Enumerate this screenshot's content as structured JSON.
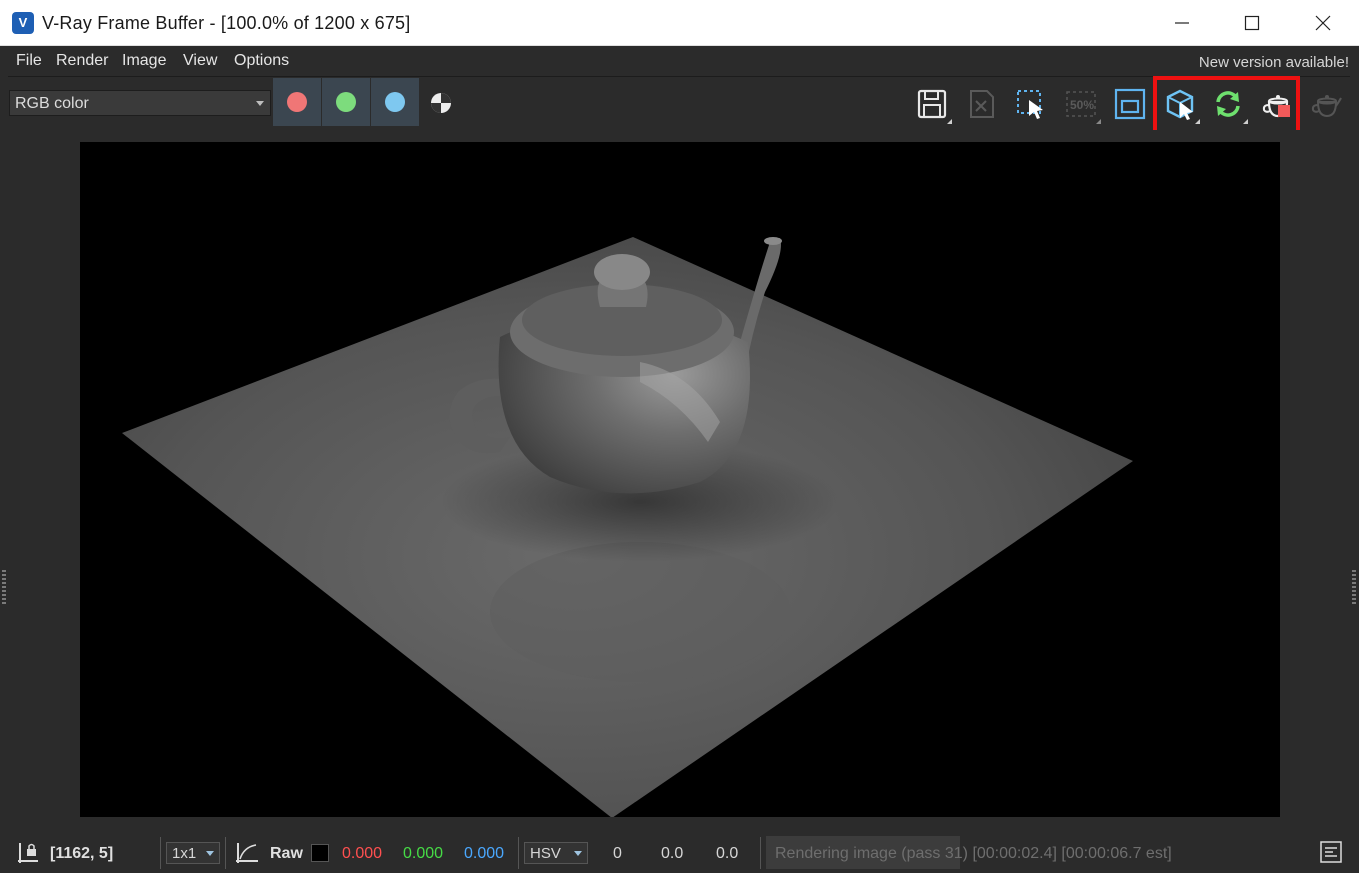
{
  "window": {
    "title": "V-Ray Frame Buffer - [100.0% of 1200 x 675]",
    "logo_letter": "V"
  },
  "menu": {
    "items": [
      "File",
      "Render",
      "Image",
      "View",
      "Options"
    ],
    "notice": "New version available!"
  },
  "toolbar": {
    "channel": "RGB color",
    "channel_buttons": [
      {
        "name": "red-channel",
        "color": "#f07676"
      },
      {
        "name": "green-channel",
        "color": "#7ddc7d"
      },
      {
        "name": "blue-channel",
        "color": "#7ec8f0"
      }
    ],
    "tools": [
      {
        "name": "save-image-icon"
      },
      {
        "name": "clear-image-icon"
      },
      {
        "name": "region-select-icon"
      },
      {
        "name": "half-resolution-icon",
        "label": "50%"
      },
      {
        "name": "compare-icon"
      },
      {
        "name": "interactive-render-icon"
      },
      {
        "name": "update-render-icon"
      },
      {
        "name": "stop-render-icon"
      },
      {
        "name": "render-teapot-icon"
      }
    ],
    "highlight_color": "#ee1111"
  },
  "status": {
    "coords": "[1162, 5]",
    "sampling": "1x1",
    "mode": "Raw",
    "r": "0.000",
    "g": "0.000",
    "b": "0.000",
    "color_space": "HSV",
    "h": "0",
    "s": "0.0",
    "v": "0.0",
    "render_status": "Rendering image (pass 31) [00:00:02.4] [00:00:06.7 est]",
    "colors": {
      "r": "#ff5050",
      "g": "#46dc46",
      "b": "#4aa8ff"
    }
  }
}
